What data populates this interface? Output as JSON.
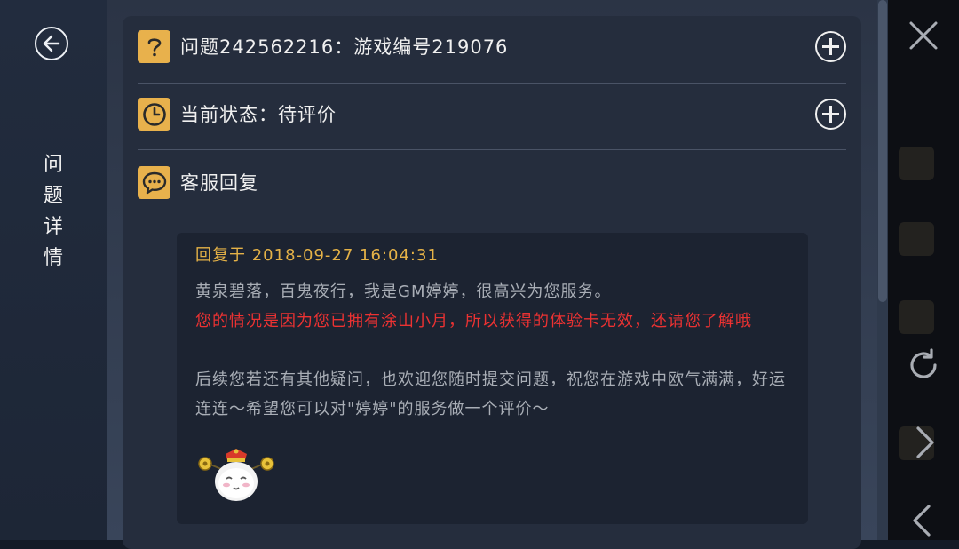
{
  "sidebar": {
    "back_icon": "arrow-left-circle-icon",
    "title_chars": [
      "问",
      "题",
      "详",
      "情"
    ]
  },
  "question": {
    "icon": "question-mark-icon",
    "label": "问题242562216：游戏编号219076",
    "expand_icon": "plus-circle-icon"
  },
  "status": {
    "icon": "clock-icon",
    "label": "当前状态：待评价",
    "expand_icon": "plus-circle-icon"
  },
  "reply_section": {
    "icon": "chat-bubble-icon",
    "label": "客服回复"
  },
  "reply": {
    "time_label": "回复于  2018-09-27  16:04:31",
    "lines": [
      "黄泉碧落，百鬼夜行，我是GM婷婷，很高兴为您服务。",
      "您的情况是因为您已拥有涂山小月，所以获得的体验卡无效，还请您了解哦",
      "后续您若还有其他疑问，也欢迎您随时提交问题，祝您在游戏中欧气满满，好运连连～希望您可以对\"婷婷\"的服务做一个评价～"
    ],
    "sticker": "mascot-sticker-icon"
  },
  "right_controls": {
    "close_icon": "close-icon",
    "refresh_icon": "refresh-icon",
    "forward_icon": "chevron-right-icon",
    "back_icon": "chevron-left-icon"
  },
  "colors": {
    "accent": "#e8b14c",
    "highlight_text": "#ec3232",
    "time_text": "#e5b247",
    "panel": "#252d3d"
  }
}
